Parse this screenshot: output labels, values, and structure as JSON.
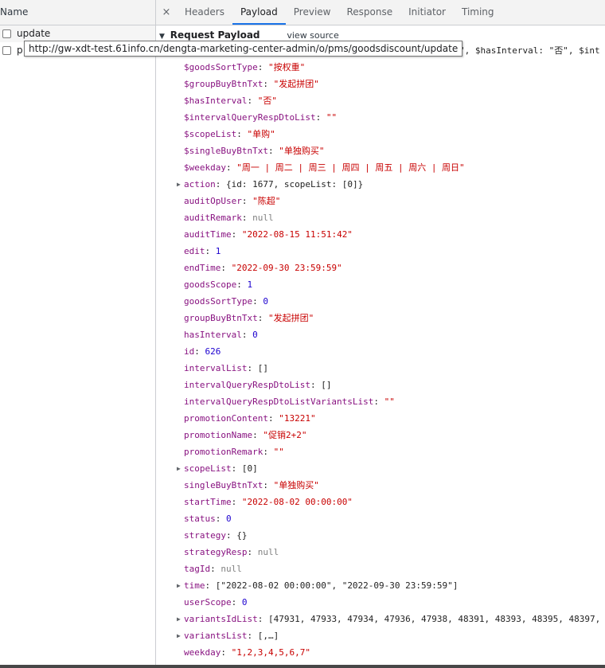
{
  "left_panel": {
    "header": "Name",
    "requests": [
      {
        "name": "update"
      },
      {
        "name": "p"
      }
    ]
  },
  "tooltip": "http://gw-xdt-test.61info.cn/dengta-marketing-center-admin/o/pms/goodsdiscount/update",
  "tabs": {
    "close_symbol": "×",
    "items": [
      "Headers",
      "Payload",
      "Preview",
      "Response",
      "Initiator",
      "Timing"
    ],
    "active": "Payload"
  },
  "payload": {
    "section_title": "Request Payload",
    "view_source": "view source",
    "first_line_tail": "日\", $hasInterval: \"否\", $int",
    "rows": [
      {
        "key": "$goodsSortType",
        "value": "\"按权重\"",
        "kind": "str"
      },
      {
        "key": "$groupBuyBtnTxt",
        "value": "\"发起拼团\"",
        "kind": "str"
      },
      {
        "key": "$hasInterval",
        "value": "\"否\"",
        "kind": "str"
      },
      {
        "key": "$intervalQueryRespDtoList",
        "value": "\"\"",
        "kind": "str"
      },
      {
        "key": "$scopeList",
        "value": "\"单购\"",
        "kind": "str"
      },
      {
        "key": "$singleBuyBtnTxt",
        "value": "\"单独购买\"",
        "kind": "str"
      },
      {
        "key": "$weekday",
        "value": "\"周一 | 周二 | 周三 | 周四 | 周五 | 周六 | 周日\"",
        "kind": "str"
      },
      {
        "key": "action",
        "value": "{id: 1677, scopeList: [0]}",
        "kind": "plain",
        "expandable": true
      },
      {
        "key": "auditOpUser",
        "value": "\"陈超\"",
        "kind": "str"
      },
      {
        "key": "auditRemark",
        "value": "null",
        "kind": "nul"
      },
      {
        "key": "auditTime",
        "value": "\"2022-08-15 11:51:42\"",
        "kind": "str"
      },
      {
        "key": "edit",
        "value": "1",
        "kind": "num"
      },
      {
        "key": "endTime",
        "value": "\"2022-09-30 23:59:59\"",
        "kind": "str"
      },
      {
        "key": "goodsScope",
        "value": "1",
        "kind": "num"
      },
      {
        "key": "goodsSortType",
        "value": "0",
        "kind": "num"
      },
      {
        "key": "groupBuyBtnTxt",
        "value": "\"发起拼团\"",
        "kind": "str"
      },
      {
        "key": "hasInterval",
        "value": "0",
        "kind": "num"
      },
      {
        "key": "id",
        "value": "626",
        "kind": "num"
      },
      {
        "key": "intervalList",
        "value": "[]",
        "kind": "plain"
      },
      {
        "key": "intervalQueryRespDtoList",
        "value": "[]",
        "kind": "plain"
      },
      {
        "key": "intervalQueryRespDtoListVariantsList",
        "value": "\"\"",
        "kind": "str"
      },
      {
        "key": "promotionContent",
        "value": "\"13221\"",
        "kind": "str"
      },
      {
        "key": "promotionName",
        "value": "\"促销2+2\"",
        "kind": "str"
      },
      {
        "key": "promotionRemark",
        "value": "\"\"",
        "kind": "str"
      },
      {
        "key": "scopeList",
        "value": "[0]",
        "kind": "plain",
        "expandable": true
      },
      {
        "key": "singleBuyBtnTxt",
        "value": "\"单独购买\"",
        "kind": "str"
      },
      {
        "key": "startTime",
        "value": "\"2022-08-02 00:00:00\"",
        "kind": "str"
      },
      {
        "key": "status",
        "value": "0",
        "kind": "num"
      },
      {
        "key": "strategy",
        "value": "{}",
        "kind": "plain"
      },
      {
        "key": "strategyResp",
        "value": "null",
        "kind": "nul"
      },
      {
        "key": "tagId",
        "value": "null",
        "kind": "nul"
      },
      {
        "key": "time",
        "value": "[\"2022-08-02 00:00:00\", \"2022-09-30 23:59:59\"]",
        "kind": "plain",
        "expandable": true
      },
      {
        "key": "userScope",
        "value": "0",
        "kind": "num"
      },
      {
        "key": "variantsIdList",
        "value": "[47931, 47933, 47934, 47936, 47938, 48391, 48393, 48395, 48397,",
        "kind": "plain",
        "expandable": true
      },
      {
        "key": "variantsList",
        "value": "[,…]",
        "kind": "plain",
        "expandable": true
      },
      {
        "key": "weekday",
        "value": "\"1,2,3,4,5,6,7\"",
        "kind": "str"
      }
    ]
  }
}
